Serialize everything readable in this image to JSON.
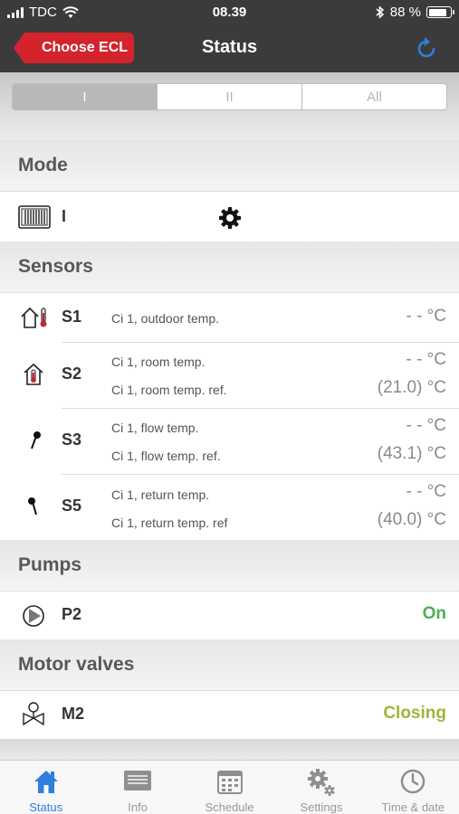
{
  "statusbar": {
    "carrier": "TDC",
    "time": "08.39",
    "battery": "88 %"
  },
  "navbar": {
    "back_label": "Choose ECL",
    "title": "Status"
  },
  "segments": [
    "I",
    "II",
    "All"
  ],
  "mode": {
    "header": "Mode",
    "value": "I"
  },
  "sensors": {
    "header": "Sensors",
    "items": [
      {
        "code": "S1",
        "icon": "outdoor-sensor-icon",
        "lines": [
          {
            "label": "Ci 1, outdoor temp.",
            "value": "- - °C"
          }
        ]
      },
      {
        "code": "S2",
        "icon": "room-sensor-icon",
        "lines": [
          {
            "label": "Ci 1, room temp.",
            "value": "- - °C"
          },
          {
            "label": "Ci 1, room temp. ref.",
            "value": "(21.0) °C"
          }
        ]
      },
      {
        "code": "S3",
        "icon": "flow-sensor-icon",
        "lines": [
          {
            "label": "Ci 1, flow temp.",
            "value": "- - °C"
          },
          {
            "label": "Ci 1, flow temp. ref.",
            "value": "(43.1) °C"
          }
        ]
      },
      {
        "code": "S5",
        "icon": "return-sensor-icon",
        "lines": [
          {
            "label": "Ci 1, return temp.",
            "value": "- - °C"
          },
          {
            "label": "Ci 1, return temp. ref",
            "value": "(40.0) °C"
          }
        ]
      }
    ]
  },
  "pumps": {
    "header": "Pumps",
    "code": "P2",
    "status": "On"
  },
  "valves": {
    "header": "Motor valves",
    "code": "M2",
    "status": "Closing"
  },
  "tabs": [
    "Status",
    "Info",
    "Schedule",
    "Settings",
    "Time & date"
  ],
  "colors": {
    "accent": "#2f7fe0",
    "brand_red": "#d3242c",
    "on": "#4caf50",
    "closing": "#a4b23a"
  }
}
